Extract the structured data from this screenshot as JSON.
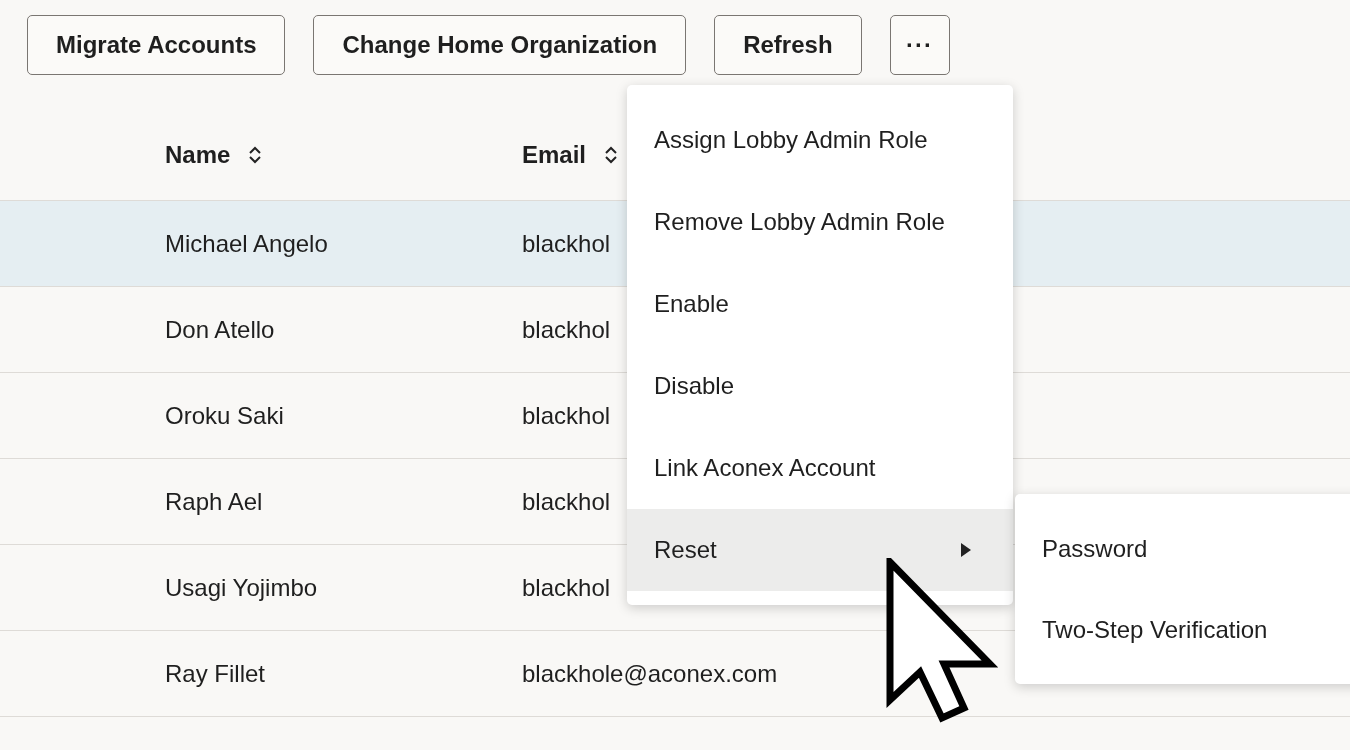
{
  "toolbar": {
    "buttons": [
      {
        "label": "Migrate Accounts",
        "kind": "text"
      },
      {
        "label": "Change Home Organization",
        "kind": "text"
      },
      {
        "label": "Refresh",
        "kind": "text"
      },
      {
        "label": "···",
        "kind": "more"
      }
    ]
  },
  "table": {
    "columns": [
      {
        "label": "Name",
        "sortable": true
      },
      {
        "label": "Email",
        "sortable": true
      }
    ],
    "rows": [
      {
        "name": "Michael Angelo",
        "email": "blackhol",
        "selected": true
      },
      {
        "name": "Don Atello",
        "email": "blackhol",
        "selected": false
      },
      {
        "name": "Oroku Saki",
        "email": "blackhol",
        "selected": false
      },
      {
        "name": "Raph Ael",
        "email": "blackhol",
        "selected": false
      },
      {
        "name": "Usagi Yojimbo",
        "email": "blackhol",
        "selected": false
      },
      {
        "name": "Ray Fillet",
        "email": "blackhole@aconex.com",
        "selected": false
      }
    ]
  },
  "menu": {
    "items": [
      {
        "label": "Assign Lobby Admin Role",
        "kind": "action",
        "selected": false
      },
      {
        "label": "Remove Lobby Admin Role",
        "kind": "action",
        "selected": false
      },
      {
        "label": "Enable",
        "kind": "action",
        "selected": false
      },
      {
        "label": "Disable",
        "kind": "action",
        "selected": false
      },
      {
        "label": "Link Aconex Account",
        "kind": "action",
        "selected": false
      },
      {
        "label": "Reset",
        "kind": "submenu",
        "selected": true
      }
    ]
  },
  "submenu": {
    "items": [
      {
        "label": "Password",
        "selected": false
      },
      {
        "label": "Two-Step Verification",
        "selected": false
      }
    ]
  }
}
